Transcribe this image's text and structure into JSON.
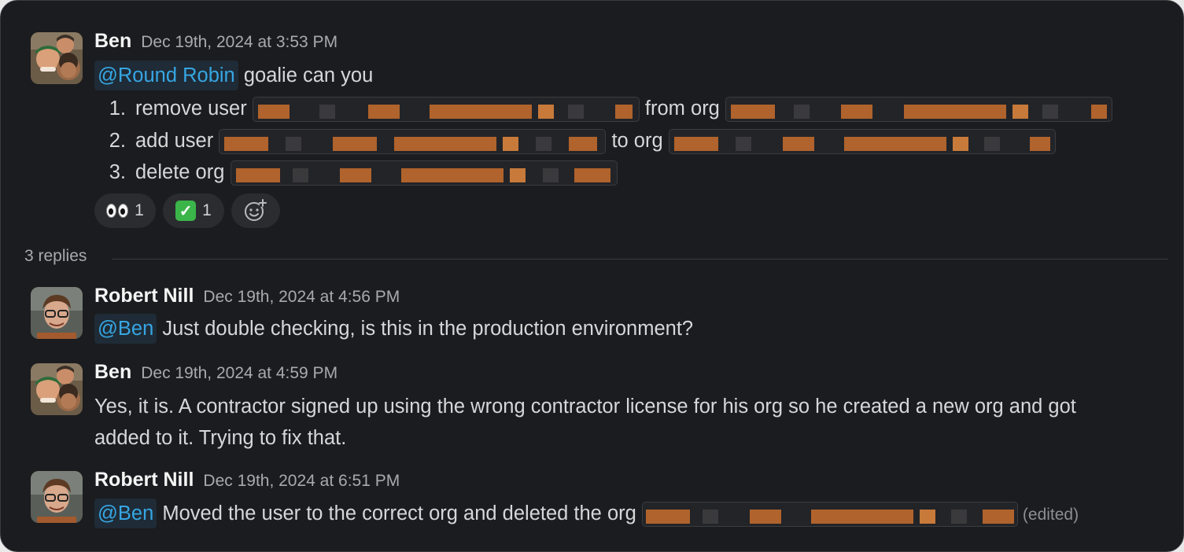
{
  "thread": {
    "parent": {
      "author": "Ben",
      "timestamp": "Dec 19th, 2024 at 3:53 PM",
      "mention": "@Round Robin",
      "intro": "goalie can you",
      "items": [
        {
          "num": "1.",
          "text_a": "remove user",
          "text_b": "from org"
        },
        {
          "num": "2.",
          "text_a": "add user",
          "text_b": "to org"
        },
        {
          "num": "3.",
          "text_a": "delete org",
          "text_b": ""
        }
      ],
      "reactions": [
        {
          "icon": "eyes-emoji",
          "count": "1"
        },
        {
          "icon": "white-check-mark-emoji",
          "count": "1"
        },
        {
          "icon": "add-reaction-icon",
          "count": ""
        }
      ]
    },
    "replies_label": "3 replies",
    "replies": [
      {
        "author": "Robert Nill",
        "timestamp": "Dec 19th, 2024 at 4:56 PM",
        "mention": "@Ben",
        "text": "Just double checking, is this in the production environment?"
      },
      {
        "author": "Ben",
        "timestamp": "Dec 19th, 2024 at 4:59 PM",
        "line1": "Yes, it is.  A contractor signed up using the wrong contractor license for his org so he created a new org and got",
        "line2": "added to it.  Trying to fix that."
      },
      {
        "author": "Robert Nill",
        "timestamp": "Dec 19th, 2024 at 6:51 PM",
        "mention": "@Ben",
        "text": "Moved the user to the correct org and deleted the org",
        "edited": "(edited)"
      }
    ]
  },
  "colors": {
    "background": "#1b1c1f",
    "mention": "#36a6e3",
    "redaction": "#b0632c"
  }
}
